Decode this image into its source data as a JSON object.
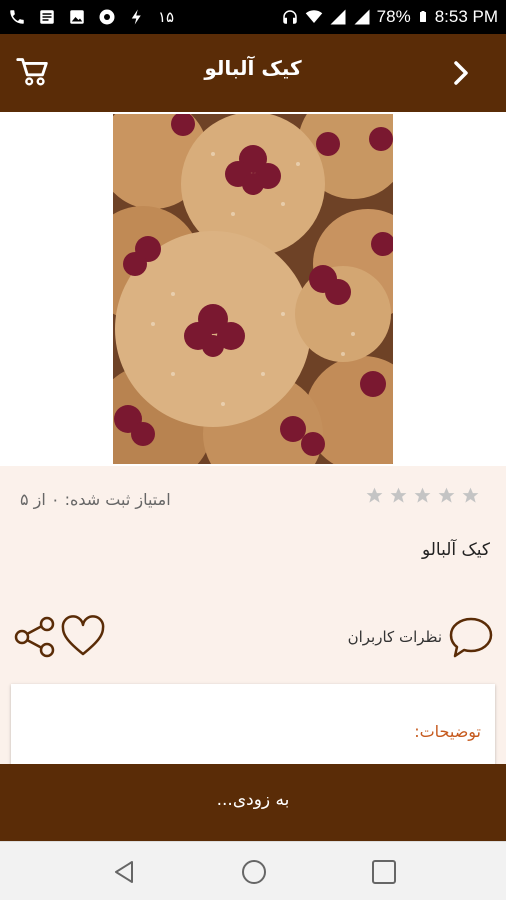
{
  "status_bar": {
    "left_number": "۱۵",
    "battery": "78%",
    "time": "8:53 PM"
  },
  "app_bar": {
    "title": "کیک آلبالو"
  },
  "rating": {
    "stars_filled": 0,
    "stars_total": 5,
    "text": "امتیاز ثبت شده: ۰ از ۵"
  },
  "recipe": {
    "name": "کیک آلبالو"
  },
  "actions": {
    "comments_label": "نظرات کاربران"
  },
  "description": {
    "title": "توضیحات:"
  },
  "bottom": {
    "text": "به زودی..."
  },
  "colors": {
    "brand": "#5a2c07",
    "background": "#fbf1eb",
    "accent": "#c65a1e"
  }
}
